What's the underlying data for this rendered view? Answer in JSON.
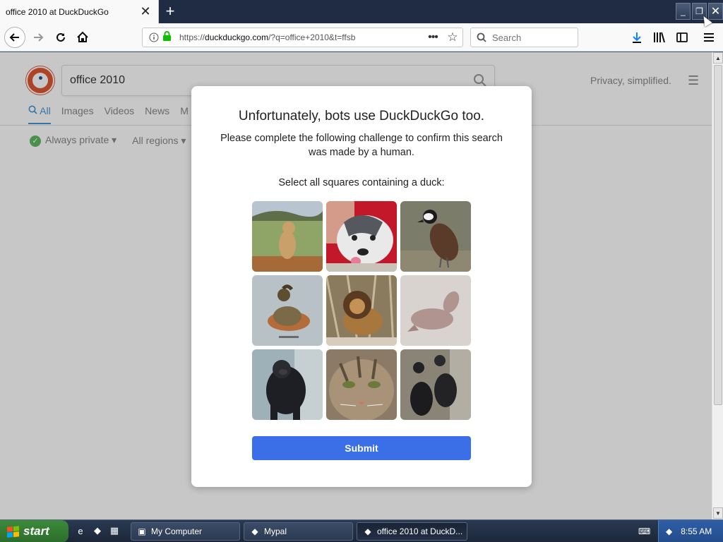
{
  "browser": {
    "tab_title": "office 2010 at DuckDuckGo",
    "tab_close_glyph": "✕",
    "new_tab_glyph": "+",
    "url_prefix": "https://",
    "url_domain": "duckduckgo.com",
    "url_path": "/?q=office+2010&t=ffsb",
    "more_glyph": "•••",
    "search_placeholder": "Search",
    "window_buttons": [
      "_",
      "❐",
      "✕"
    ]
  },
  "ddg": {
    "query": "office 2010",
    "privacy_text": "Privacy, simplified.",
    "tabs": [
      "All",
      "Images",
      "Videos",
      "News",
      "M"
    ],
    "active_tab": "All",
    "filter_private": "Always private ▾",
    "filter_region": "All regions ▾"
  },
  "modal": {
    "title": "Unfortunately, bots use DuckDuckGo too.",
    "subtitle": "Please complete the following challenge to confirm this search was made by a human.",
    "instruction": "Select all squares containing a duck:",
    "submit_label": "Submit",
    "tiles": [
      {
        "subject": "lion cub"
      },
      {
        "subject": "husky dog"
      },
      {
        "subject": "duck"
      },
      {
        "subject": "duck"
      },
      {
        "subject": "lion"
      },
      {
        "subject": "seal"
      },
      {
        "subject": "gorilla"
      },
      {
        "subject": "cat"
      },
      {
        "subject": "ducks"
      }
    ]
  },
  "taskbar": {
    "start_label": "start",
    "tasks": [
      {
        "label": "My Computer",
        "icon": "computer-icon"
      },
      {
        "label": "Mypal",
        "icon": "mypal-icon"
      },
      {
        "label": "office 2010 at DuckD...",
        "icon": "mypal-icon"
      }
    ],
    "clock": "8:55 AM"
  },
  "colors": {
    "accent_blue": "#3b6fe8",
    "ddg_orange": "#de5833",
    "tab_active_blue": "#4495d4",
    "check_green": "#5fb85f"
  }
}
